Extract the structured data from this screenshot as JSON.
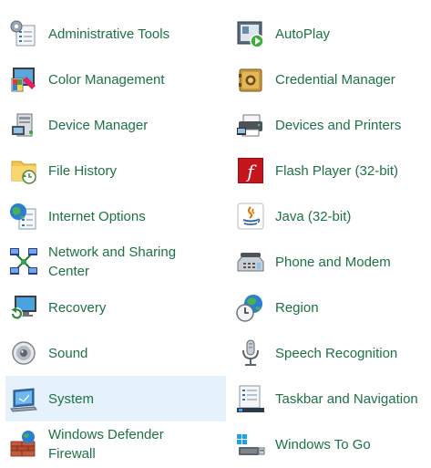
{
  "items": [
    {
      "label": "Administrative Tools",
      "icon": "administrative-tools-icon"
    },
    {
      "label": "AutoPlay",
      "icon": "autoplay-icon"
    },
    {
      "label": "Color Management",
      "icon": "color-management-icon"
    },
    {
      "label": "Credential Manager",
      "icon": "credential-manager-icon"
    },
    {
      "label": "Device Manager",
      "icon": "device-manager-icon"
    },
    {
      "label": "Devices and Printers",
      "icon": "devices-printers-icon"
    },
    {
      "label": "File History",
      "icon": "file-history-icon"
    },
    {
      "label": "Flash Player (32-bit)",
      "icon": "flash-player-icon"
    },
    {
      "label": "Internet Options",
      "icon": "internet-options-icon"
    },
    {
      "label": "Java (32-bit)",
      "icon": "java-icon"
    },
    {
      "label": "Network and Sharing Center",
      "icon": "network-sharing-icon"
    },
    {
      "label": "Phone and Modem",
      "icon": "phone-modem-icon"
    },
    {
      "label": "Recovery",
      "icon": "recovery-icon"
    },
    {
      "label": "Region",
      "icon": "region-icon"
    },
    {
      "label": "Sound",
      "icon": "sound-icon"
    },
    {
      "label": "Speech Recognition",
      "icon": "speech-recognition-icon"
    },
    {
      "label": "System",
      "icon": "system-icon",
      "selected": true
    },
    {
      "label": "Taskbar and Navigation",
      "icon": "taskbar-navigation-icon"
    },
    {
      "label": "Windows Defender Firewall",
      "icon": "firewall-icon"
    },
    {
      "label": "Windows To Go",
      "icon": "windows-to-go-icon"
    }
  ],
  "colors": {
    "link_text": "#1e7145",
    "selected_background": "#e5f1fb"
  }
}
